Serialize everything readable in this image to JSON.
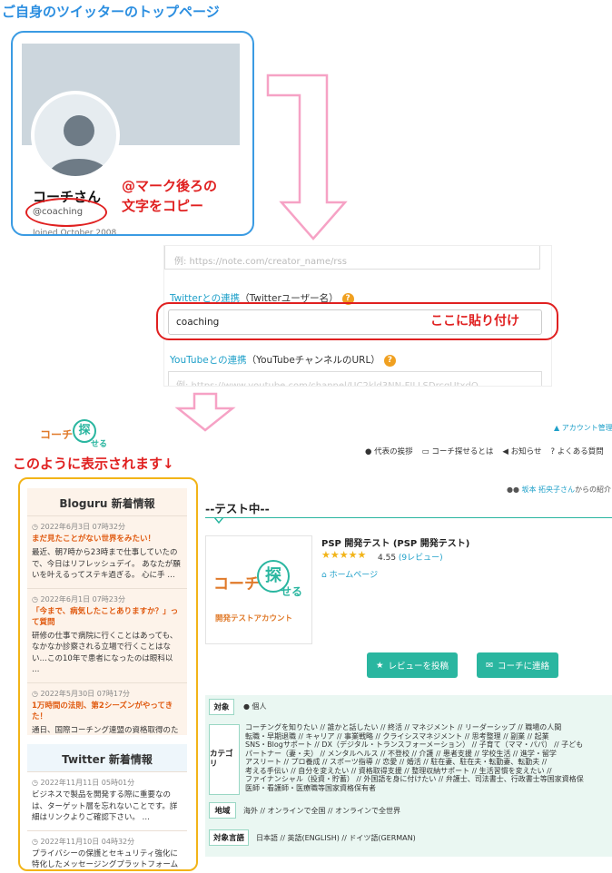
{
  "heading_top": "ご自身のツイッターのトップページ",
  "twitter_profile": {
    "name": "コーチさん",
    "handle": "@coaching",
    "joined": "Joined October 2008",
    "note_line1": "@マーク後ろの",
    "note_line2": "文字をコピー"
  },
  "form": {
    "top_placeholder": "例: https://note.com/creator_name/rss",
    "twitter_label_link": "Twitterとの連携",
    "twitter_label_rest": "（Twitterユーザー名）",
    "twitter_value": "coaching",
    "paste_note": "ここに貼り付け",
    "youtube_label_link": "YouTubeとの連携",
    "youtube_label_rest": "（YouTubeチャンネルのURL）",
    "youtube_placeholder": "例: https://www.youtube.com/channel/UC2kld3NN-FILLSDrcgUtxdQ",
    "help_glyph": "?"
  },
  "display_note": "このように表示されます↓",
  "site": {
    "logo_text_left": "コーチ",
    "logo_text_circle": "探",
    "logo_text_right": "せる",
    "account_link": "アカウント管理",
    "nav": [
      "代表の挨拶",
      "コーチ探せるとは",
      "お知らせ",
      "よくある質問"
    ],
    "intro_link": "坂本 拓央子さん",
    "intro_rest": "からの紹介",
    "test_heading": "--テスト中--",
    "coach_name": "PSP 開発テスト (PSP 開発テスト)",
    "stars": "★★★★★",
    "rating_value": "4.55",
    "rating_reviews": "(9レビュー)",
    "homepage": "ホームページ",
    "card_subtitle": "開発テストアカウント",
    "btn_review": "レビューを投稿",
    "btn_contact": "コーチに連絡",
    "target_label": "対象",
    "target_value": "個人",
    "category_label": "カテゴリ",
    "category_lines": [
      "コーチングを知りたい // 誰かと話したい // 終活 // マネジメント // リーダーシップ // 職場の人間",
      "転職・早期退職 // キャリア // 事業戦略 // クライシスマネジメント // 思考整理 // 副業 // 起業",
      "SNS・Blogサポート // DX（デジタル・トランスフォーメーション） // 子育て（ママ・パパ） // 子ども",
      "パートナー（妻・夫） // メンタルヘルス // 不登校 // 介護 // 患者支援 // 学校生活 // 進学・留学",
      "アスリート // プロ養成 // スポーツ指導 // 恋愛 // 婚活 // 駐在妻、駐在夫・転勤妻、転勤夫 //",
      "考える手伝い // 自分を変えたい // 資格取得支援 // 整理収納サポート // 生活習慣を変えたい //",
      "ファイナンシャル（投資・貯蓄） // 外国語を身に付けたい // 弁護士、司法書士、行政書士等国家資格保",
      "医師・看護師・医療職等国家資格保有者"
    ],
    "region_label": "地域",
    "region_value": "海外 // オンラインで全国 // オンラインで全世界",
    "language_label": "対象言語",
    "language_value": "日本語 // 英語(ENGLISH) // ドイツ語(GERMAN)"
  },
  "bloguru": {
    "title": "Bloguru 新着情報",
    "entries": [
      {
        "date": "2022年6月3日 07時32分",
        "title": "まだ見たことがない世界をみたい！",
        "body": "最近、朝7時から23時まで仕事していたので、今日はリフレッシュデイ。 あなたが願いを叶えるってステキ過ぎる。 心に手 …"
      },
      {
        "date": "2022年6月1日 07時23分",
        "title": "「今まで、病気したことありますか？」って質問",
        "body": "研修の仕事で病院に行くことはあっても、なかなか診察される立場で行くことはない…この10年で患者になったのは眼科以 …"
      },
      {
        "date": "2022年5月30日 07時17分",
        "title": "1万時間の法則、第2シーズンがやってきた！",
        "body": "通日、国際コーチング連盟の資格取得のためのオブザーブセッションやメンターコーチングを平均6時間実施している。 週末は …"
      }
    ]
  },
  "twitter_feed": {
    "title": "Twitter 新着情報",
    "entries": [
      {
        "date": "2022年11月11日 05時01分",
        "body": "ビジネスで製品を開発する際に重要なのは、ターゲット層を忘れないことです。詳細はリンクよりご確認下さい。 …"
      },
      {
        "date": "2022年11月10日 04時32分",
        "body": "プライバシーの保護とセキュリティ強化に特化したメッセージングプラットフォーム"
      }
    ]
  },
  "colors": {
    "accent": "#2ab6a0",
    "alert": "#e02020",
    "frame_blue": "#3a9be3",
    "frame_gold": "#f2b418"
  }
}
